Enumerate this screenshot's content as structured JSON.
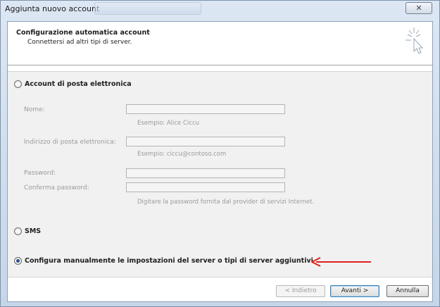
{
  "window": {
    "title": "Aggiunta nuovo account",
    "close_glyph": "✕"
  },
  "header": {
    "title": "Configurazione automatica account",
    "subtitle": "Connettersi ad altri tipi di server."
  },
  "options": {
    "email_account": {
      "label": "Account di posta elettronica",
      "selected": false
    },
    "sms": {
      "label": "SMS",
      "selected": false
    },
    "manual": {
      "label": "Configura manualmente le impostazioni del server o tipi di server aggiuntivi",
      "selected": true
    }
  },
  "form": {
    "name": {
      "label": "Nome:",
      "value": "",
      "hint": "Esempio: Alice Ciccu"
    },
    "email": {
      "label": "Indirizzo di posta elettronica:",
      "value": "",
      "hint": "Esempio: ciccu@contoso.com"
    },
    "password": {
      "label": "Password:",
      "value": ""
    },
    "confirm_password": {
      "label": "Conferma password:",
      "value": "",
      "hint": "Digitare la password fornita dal provider di servizi Internet."
    }
  },
  "buttons": {
    "back": "< Indietro",
    "next": "Avanti >",
    "cancel": "Annulla"
  },
  "annotation": {
    "arrow_color": "#e0201c"
  },
  "icons": {
    "wizard": "cursor-sparkle-icon",
    "close": "close-icon"
  },
  "colors": {
    "radio_dot": "#2a4e87",
    "disabled_text": "#9a9a9a"
  }
}
